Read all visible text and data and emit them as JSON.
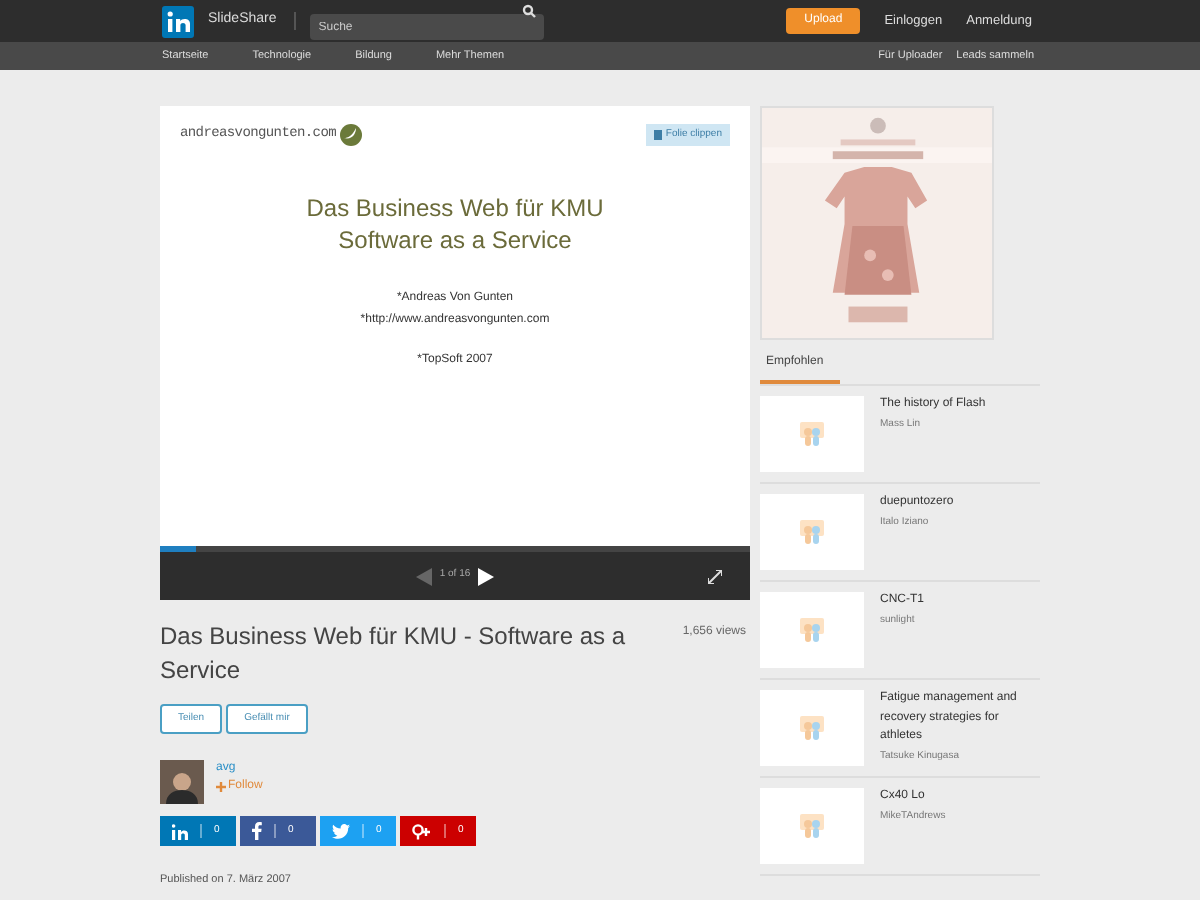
{
  "header": {
    "brand": "SlideShare",
    "search_placeholder": "Suche",
    "upload": "Upload",
    "links": [
      "Einloggen",
      "Anmeldung"
    ]
  },
  "nav": {
    "left": [
      "Startseite",
      "Technologie",
      "Bildung",
      "Mehr Themen"
    ],
    "right": [
      "Für Uploader",
      "Leads sammeln"
    ]
  },
  "slide": {
    "logo": "andreasvongunten.com",
    "clip_button": "Folie clippen",
    "title_lines": [
      "Das Business Web für KMU",
      "Software as a Service"
    ],
    "bullets": [
      "*Andreas Von Gunten",
      "*http://www.andreasvongunten.com"
    ],
    "extra": "*TopSoft 2007",
    "progress": {
      "level": 0.06
    },
    "page": "1 of 16"
  },
  "title": "Das Business Web für KMU - Software as a Service",
  "views": "1,656 views",
  "actions": [
    "Teilen",
    "Gefällt mir"
  ],
  "author": {
    "name": "avg",
    "follow": "Follow"
  },
  "shares": [
    {
      "kind": "linkedin",
      "count": "0",
      "color": "#0077b5"
    },
    {
      "kind": "facebook",
      "count": "0",
      "color": "#3b5998"
    },
    {
      "kind": "twitter",
      "count": "0",
      "color": "#1da1f2"
    },
    {
      "kind": "google",
      "count": "0",
      "color": "#cc0000"
    }
  ],
  "published": "Published on 7. März 2007",
  "sidebar": {
    "tab": "Empfohlen",
    "items": [
      {
        "title": "The history of Flash",
        "author": "Mass Lin"
      },
      {
        "title": "duepuntozero",
        "author": "Italo Iziano"
      },
      {
        "title": "CNC-T1",
        "author": "sunlight"
      },
      {
        "title": "Fatigue management and recovery strategies for athletes",
        "author": "Tatsuke Kinugasa"
      },
      {
        "title": "Cx40 Lo",
        "author": "MikeTAndrews"
      }
    ]
  }
}
